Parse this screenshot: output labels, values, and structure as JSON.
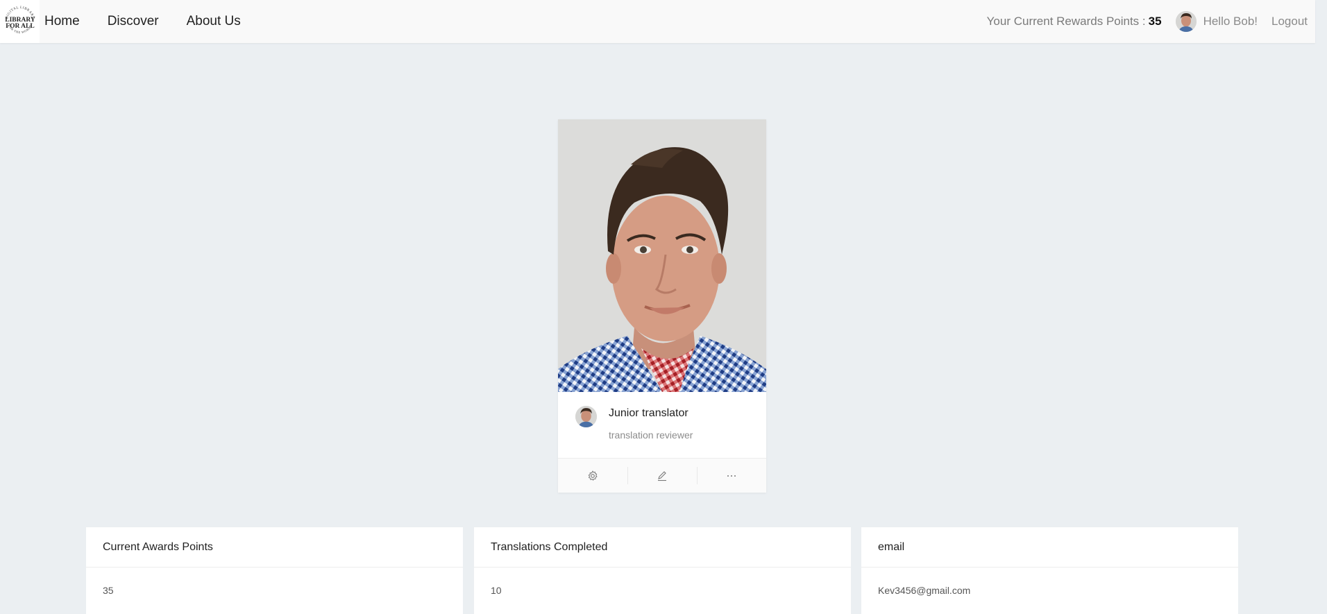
{
  "logo": {
    "top_text": "DIGITAL LIBRARY",
    "main_line1": "LIBRARY",
    "main_line2": "FOR ALL",
    "bottom_text": "FOR THE WORLD"
  },
  "nav": {
    "home": "Home",
    "discover": "Discover",
    "about": "About Us"
  },
  "header": {
    "rewards_label": "Your Current Rewards Points :",
    "rewards_value": "35",
    "greeting": "Hello Bob!",
    "logout": "Logout"
  },
  "profile": {
    "title": "Junior translator",
    "description": "translation reviewer"
  },
  "actions": [
    "settings-icon",
    "edit-icon",
    "ellipsis-icon"
  ],
  "stats": [
    {
      "label": "Current Awards Points",
      "value": "35"
    },
    {
      "label": "Translations Completed",
      "value": "10"
    },
    {
      "label": "email",
      "value": "Kev3456@gmail.com"
    }
  ]
}
